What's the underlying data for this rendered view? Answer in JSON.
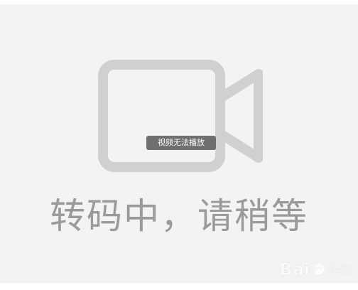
{
  "player": {
    "tooltip": "视频无法播放",
    "status": "转码中，请稍等"
  },
  "icons": {
    "camera": "video-camera-icon",
    "paw": "baidu-paw-icon"
  },
  "watermark": {
    "brand_part1": "Bai",
    "brand_part2": "经验"
  },
  "colors": {
    "background": "#f3f3f3",
    "icon": "#d0d0d0",
    "tooltip_bg": "#6f6f6f",
    "status_text": "#9a9a9a"
  }
}
